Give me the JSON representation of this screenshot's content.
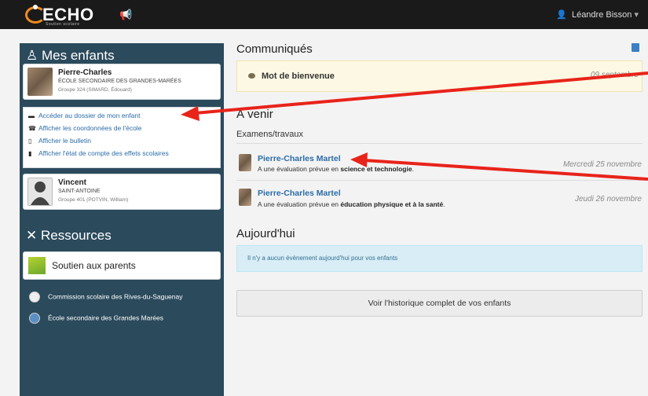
{
  "topbar": {
    "logo_text": "ECHO",
    "logo_sub": "Soutien scolaire",
    "user_name": "Léandre Bisson"
  },
  "sidebar": {
    "title": "Mes enfants",
    "children": [
      {
        "name": "Pierre-Charles",
        "school": "ÉCOLE SECONDAIRE DES GRANDES-MARÉES",
        "group": "Groupe 324",
        "teacher": "(SIMARD, Édouard)"
      },
      {
        "name": "Vincent",
        "school": "SAINT-ANTOINE",
        "group": "Groupe 401",
        "teacher": "(POTVIN, William)"
      }
    ],
    "links": [
      {
        "label": "Accéder au dossier de mon enfant",
        "icon": "folder-icon"
      },
      {
        "label": "Afficher les coordonnées de l'école",
        "icon": "phone-icon"
      },
      {
        "label": "Afficher le bulletin",
        "icon": "document-icon"
      },
      {
        "label": "Afficher l'état de compte des effets scolaires",
        "icon": "file-icon"
      }
    ],
    "resources_title": "Ressources",
    "resource_card": "Soutien aux parents",
    "resource_links": [
      "Commission scolaire des Rives-du-Saguenay",
      "École secondaire des Grandes Marées"
    ]
  },
  "main": {
    "communiques_title": "Communiqués",
    "notice_title": "Mot de bienvenue",
    "notice_date": "09 septembre",
    "avenir_title": "À venir",
    "exams_subtitle": "Examens/travaux",
    "events": [
      {
        "name": "Pierre-Charles Martel",
        "prefix": "A une évaluation prévue en ",
        "subject": "science et technologie",
        "suffix": ".",
        "date": "Mercredi 25 novembre"
      },
      {
        "name": "Pierre-Charles Martel",
        "prefix": "A une évaluation prévue en ",
        "subject": "éducation physique et à la santé",
        "suffix": ".",
        "date": "Jeudi 26 novembre"
      }
    ],
    "today_title": "Aujourd'hui",
    "today_info": "Il n'y a aucun évènement aujourd'hui pour vos enfants",
    "history_button": "Voir l'historique complet de vos enfants"
  },
  "colors": {
    "topbar": "#1a1a1a",
    "sidebar": "#2b4a5c",
    "link": "#2a6ca8",
    "notice_bg": "#fcf8e3",
    "info_bg": "#d9edf7",
    "annotation": "#e8231a",
    "brand_orange": "#f08a1d"
  }
}
